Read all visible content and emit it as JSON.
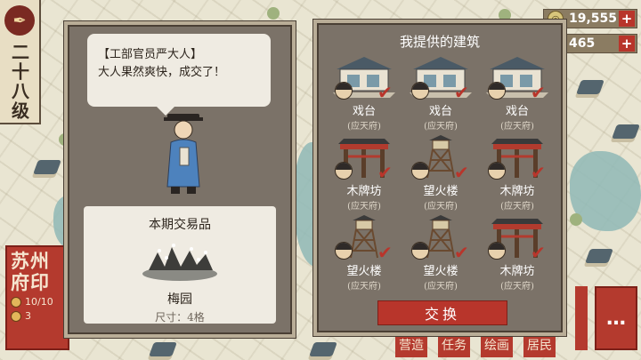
{
  "level": {
    "text": "二十八级",
    "icon": "brush-icon"
  },
  "resources": [
    {
      "icon": "coin-icon",
      "value": "19,555",
      "plus": "+"
    },
    {
      "icon": "token-icon",
      "value": "465",
      "plus": "+"
    }
  ],
  "dialog": {
    "speaker": "【工部官员严大人】",
    "message": "大人果然爽快，成交了！",
    "trade": {
      "title": "本期交易品",
      "item_name": "梅园",
      "item_size": "尺寸：4格"
    }
  },
  "buildings_panel": {
    "title": "我提供的建筑",
    "items": [
      {
        "name": "戏台",
        "location": "(应天府)",
        "type": "stage",
        "checked": true
      },
      {
        "name": "戏台",
        "location": "(应天府)",
        "type": "stage",
        "checked": true
      },
      {
        "name": "戏台",
        "location": "(应天府)",
        "type": "stage",
        "checked": true
      },
      {
        "name": "木牌坊",
        "location": "(应天府)",
        "type": "archway",
        "checked": true
      },
      {
        "name": "望火楼",
        "location": "(应天府)",
        "type": "watchtower",
        "checked": true
      },
      {
        "name": "木牌坊",
        "location": "(应天府)",
        "type": "archway",
        "checked": true
      },
      {
        "name": "望火楼",
        "location": "(应天府)",
        "type": "watchtower",
        "checked": true
      },
      {
        "name": "望火楼",
        "location": "(应天府)",
        "type": "watchtower",
        "checked": true
      },
      {
        "name": "木牌坊",
        "location": "(应天府)",
        "type": "archway",
        "checked": true
      }
    ],
    "exchange_button": "交换"
  },
  "seal": {
    "title": "苏州府印",
    "stat1": "10/10",
    "stat2": "3"
  },
  "bottom_menu": [
    "营造",
    "任务",
    "绘画",
    "居民"
  ],
  "more_button": "…",
  "colors": {
    "accent_red": "#b8352b",
    "panel": "#7b7268",
    "paper": "#efebe2"
  }
}
